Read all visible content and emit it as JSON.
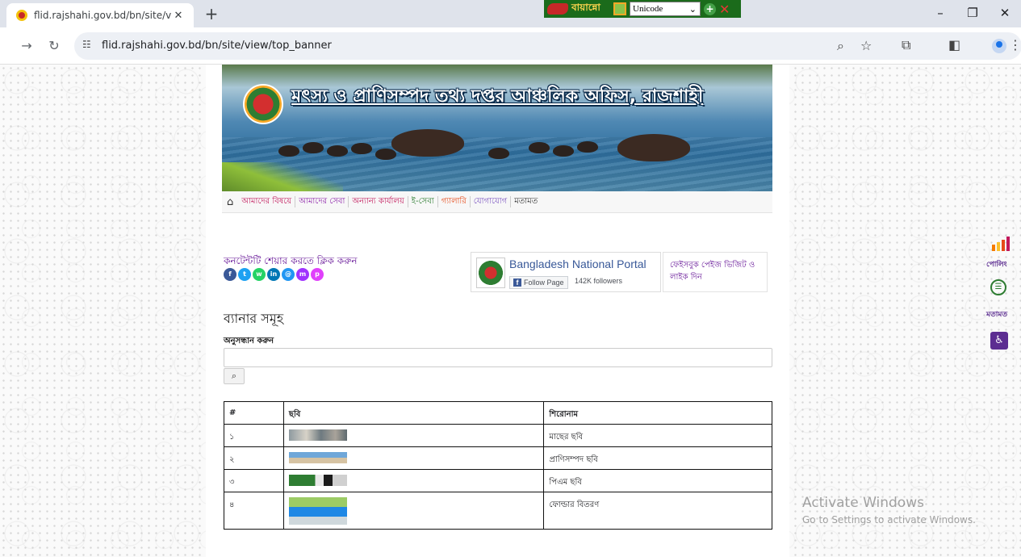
{
  "browser": {
    "tab_title": "flid.rajshahi.gov.bd/bn/site/view",
    "tab_close": "✕",
    "new_tab": "+",
    "url": "flid.rajshahi.gov.bd/bn/site/view/top_banner",
    "ime": {
      "label": "বায়ান্নো",
      "encoding": "Unicode"
    },
    "window_controls": [
      "–",
      "❐",
      "✕"
    ]
  },
  "site": {
    "banner_title": "মৎস্য ও প্রাণিসম্পদ তথ্য দপ্তর আঞ্চলিক অফিস, রাজশাহী",
    "menu": [
      {
        "label": "আমাদের বিষয়ে",
        "color": "#c2185b"
      },
      {
        "label": "আমাদের সেবা",
        "color": "#8e24aa"
      },
      {
        "label": "অন্যান্য কার্যালয়",
        "color": "#c2185b"
      },
      {
        "label": "ই-সেবা",
        "color": "#2e7d32"
      },
      {
        "label": "গ্যালারি",
        "color": "#e64a19"
      },
      {
        "label": "যোগাযোগ",
        "color": "#7e57c2"
      },
      {
        "label": "মতামত",
        "color": "#333333"
      }
    ],
    "share_label": "কনটেন্টটি শেয়ার করতে ক্লিক করুন",
    "share_icons": [
      {
        "name": "facebook-icon",
        "glyph": "f",
        "color": "#3b5998"
      },
      {
        "name": "twitter-icon",
        "glyph": "t",
        "color": "#1da1f2"
      },
      {
        "name": "whatsapp-icon",
        "glyph": "w",
        "color": "#25d366"
      },
      {
        "name": "linkedin-icon",
        "glyph": "in",
        "color": "#0077b5"
      },
      {
        "name": "email-icon",
        "glyph": "@",
        "color": "#2196f3"
      },
      {
        "name": "messenger-icon",
        "glyph": "m",
        "color": "#a033ff"
      },
      {
        "name": "print-icon",
        "glyph": "p",
        "color": "#e040fb"
      }
    ],
    "fb_widget": {
      "page_name": "Bangladesh National Portal",
      "follow_label": "Follow Page",
      "followers": "142K followers"
    },
    "fb_like_text": "ফেইসবুক পেইজ ভিজিট ও লাইক দিন"
  },
  "main": {
    "heading": "ব্যানার সমূহ",
    "search_label": "অনুসন্ধান করুন",
    "search_value": "",
    "table": {
      "headers": [
        "#",
        "ছবি",
        "শিরোনাম"
      ],
      "rows": [
        {
          "num": "১",
          "title": "মাছের ছবি"
        },
        {
          "num": "২",
          "title": "প্রাণিসম্পদ ছবি"
        },
        {
          "num": "৩",
          "title": "পিএম ছবি"
        },
        {
          "num": "৪",
          "title": "ফোল্ডার বিতরণ"
        }
      ]
    }
  },
  "sidebar": {
    "poll_label": "পোলিং",
    "feedback_label": "মতামত"
  },
  "watermark": {
    "title": "Activate Windows",
    "subtitle": "Go to Settings to activate Windows."
  }
}
